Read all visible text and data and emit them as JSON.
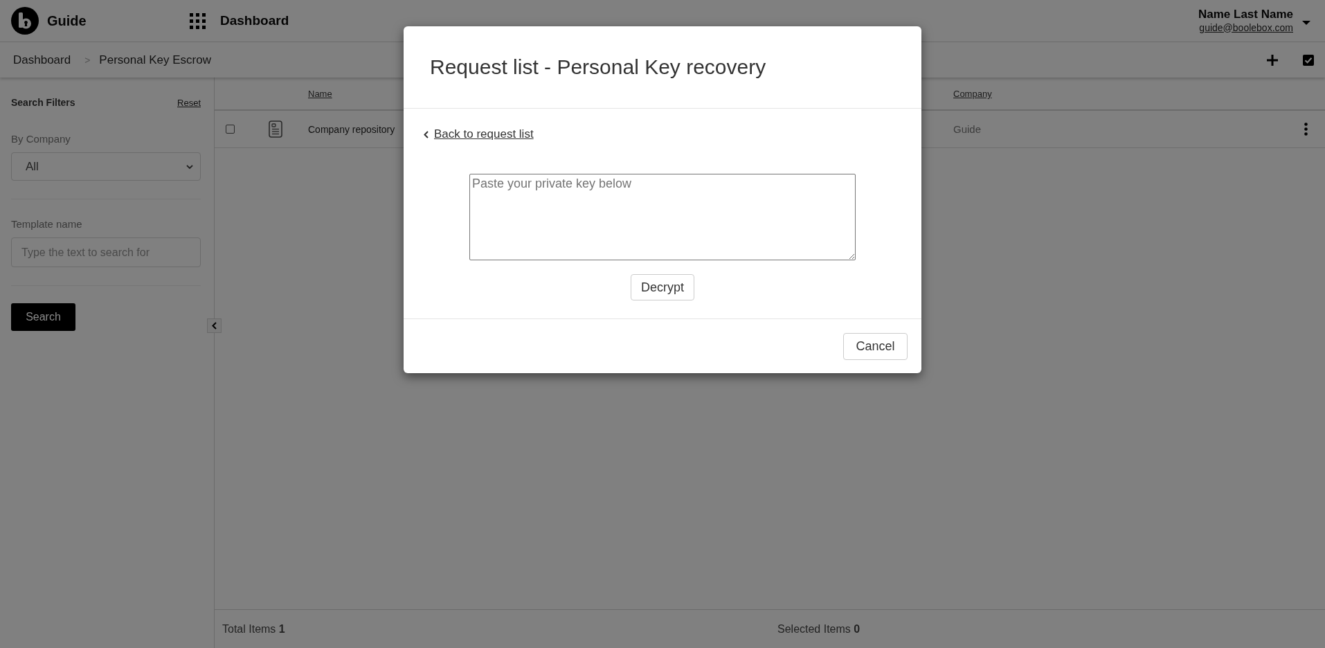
{
  "header": {
    "app_name": "Guide",
    "section": "Dashboard",
    "user": {
      "name": "Name Last Name",
      "email": "guide@boolebox.com"
    }
  },
  "breadcrumb": {
    "separator": ">",
    "items": [
      {
        "label": "Dashboard"
      },
      {
        "label": "Personal Key Escrow"
      }
    ]
  },
  "sidebar": {
    "title": "Search Filters",
    "reset": "Reset",
    "filters": [
      {
        "kind": "select",
        "label": "By Company",
        "value": "All"
      },
      {
        "kind": "text",
        "label": "Template name",
        "placeholder": "Type the text to search for"
      }
    ],
    "search_button": "Search"
  },
  "table": {
    "columns": [
      {
        "label": "Name"
      },
      {
        "label": "Company"
      }
    ],
    "rows": [
      {
        "selected": false,
        "name": "Company repository",
        "company": "Guide"
      }
    ]
  },
  "footer": {
    "total": "Total Items **1**",
    "selected": "Selected Items **0**"
  },
  "modal": {
    "title": "Request list - Personal Key recovery",
    "back_link": "Back to request list",
    "key_field": {
      "placeholder": "Paste your private key below"
    },
    "decrypt_button": "Decrypt",
    "cancel_button": "Cancel"
  }
}
